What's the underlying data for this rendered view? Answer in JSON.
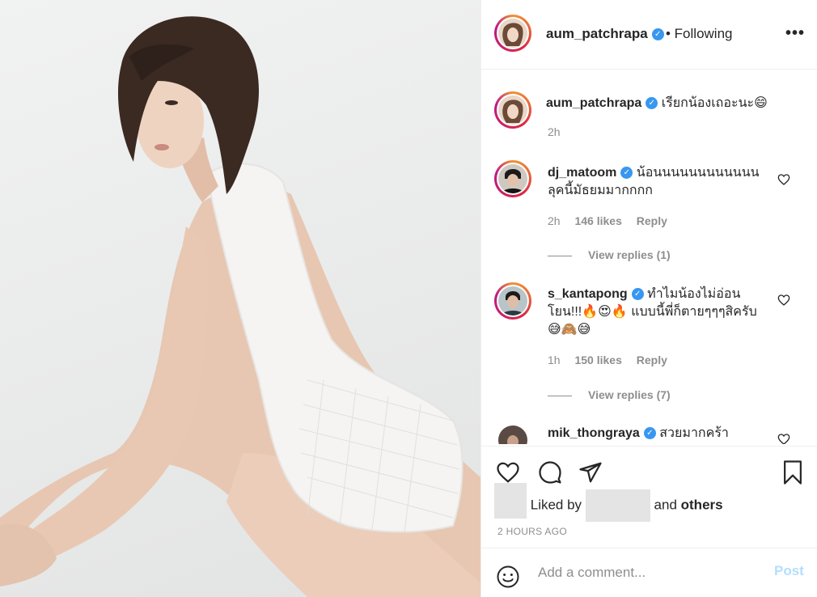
{
  "post": {
    "username": "aum_patchrapa",
    "follow_status": "• Following",
    "more_icon": "more-horizontal-icon"
  },
  "comments": [
    {
      "username": "aum_patchrapa",
      "text": "เรียกน้องเถอะนะ😄",
      "time": "2h",
      "likes": "",
      "reply_label": "",
      "view_replies": ""
    },
    {
      "username": "dj_matoom",
      "text": "น้อนนนนนนนนนนนน ลุคนี้มัธยมมากกกก",
      "time": "2h",
      "likes": "146 likes",
      "reply_label": "Reply",
      "view_replies": "View replies (1)"
    },
    {
      "username": "s_kantapong",
      "text": "ทำไมน้องไม่อ่อนโยน!!!🔥😍🔥 แบบนี้พี่ก็ตายๆๆๆสิครับ 😅🙈😅",
      "time": "1h",
      "likes": "150 likes",
      "reply_label": "Reply",
      "view_replies": "View replies (7)"
    },
    {
      "username": "mik_thongraya",
      "text": "สวยมากคร้า",
      "time": "",
      "likes": "",
      "reply_label": "",
      "view_replies": ""
    }
  ],
  "likes": {
    "prefix": "Liked by",
    "suffix_and": "and",
    "suffix_others": "others"
  },
  "timestamp": "2 HOURS AGO",
  "composer": {
    "placeholder": "Add a comment...",
    "post_label": "Post"
  },
  "colors": {
    "verified": "#3897f0",
    "muted": "#8e8e8e",
    "post_disabled": "#b2dffc",
    "story_ring": "#dc2743"
  }
}
